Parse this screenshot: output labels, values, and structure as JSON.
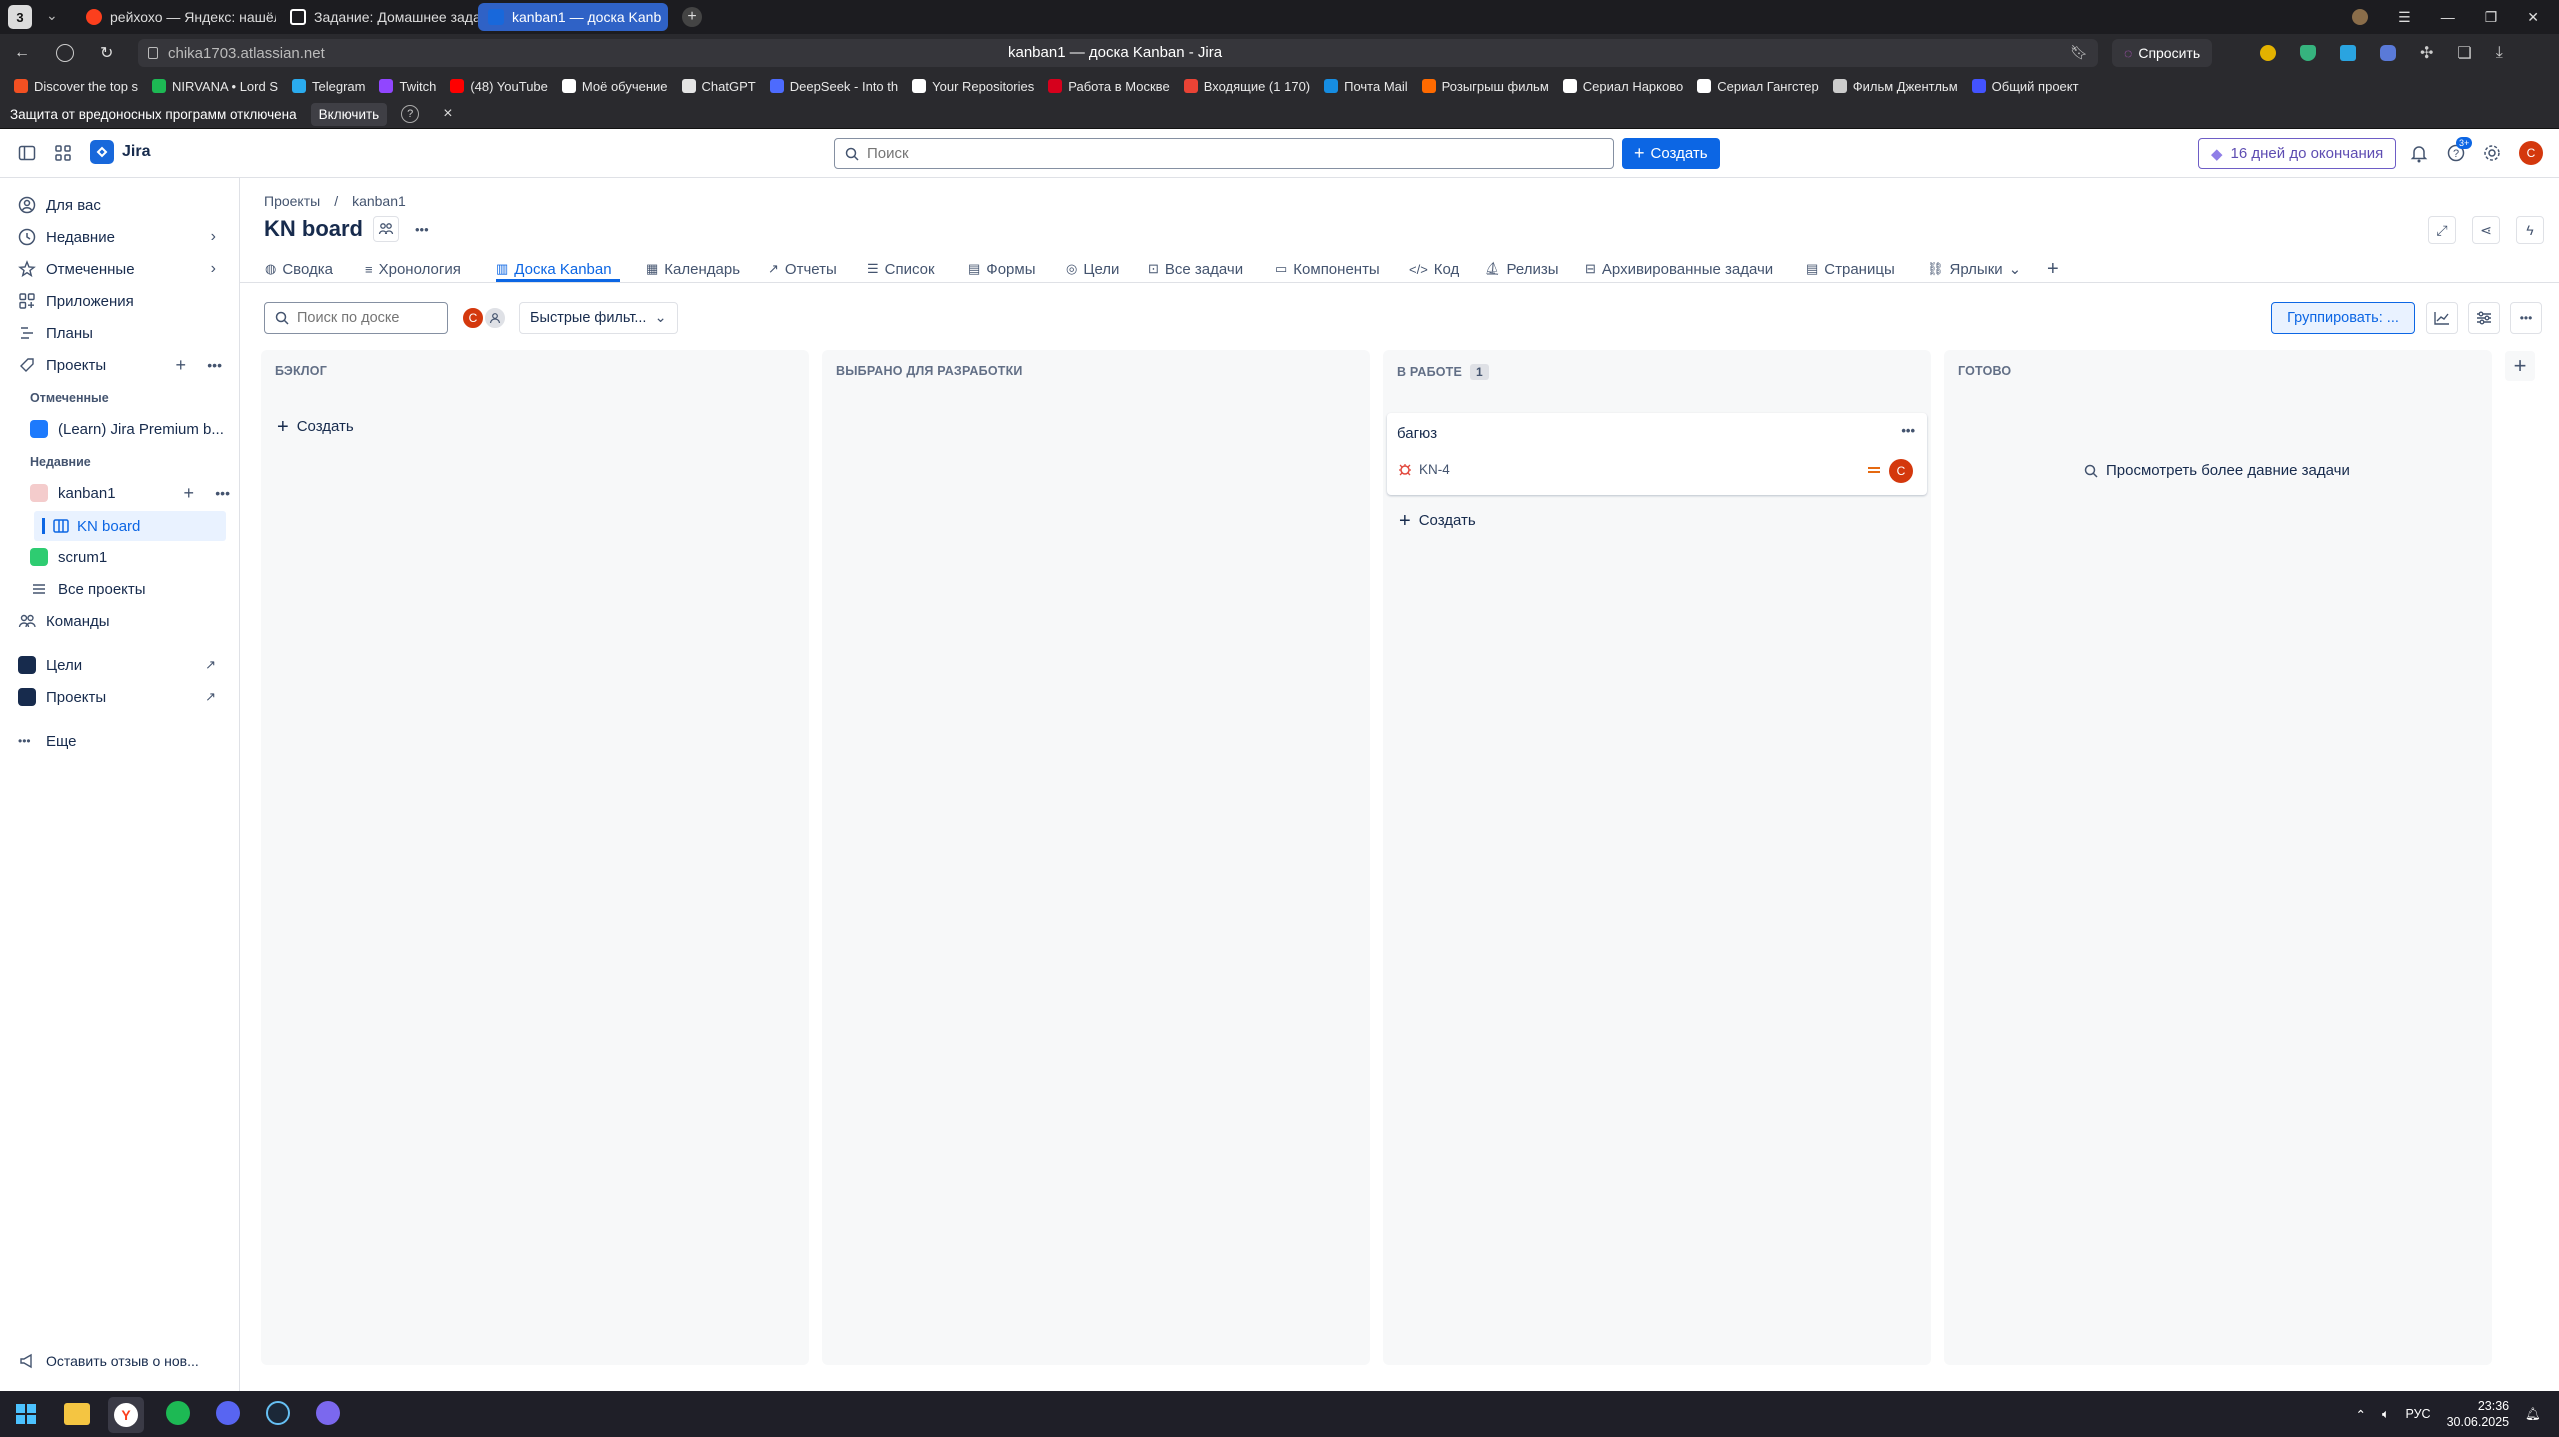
{
  "browser": {
    "tab_counter": "3",
    "tabs": [
      {
        "label": "рейхохо — Яндекс: нашёл",
        "favicon_color": "#fc3f1d"
      },
      {
        "label": "Задание: Домашнее зада",
        "favicon_color": "#ffffff"
      },
      {
        "label": "kanban1 — доска Kanb",
        "favicon_color": "#1868db"
      }
    ],
    "url": "chika1703.atlassian.net",
    "page_title": "kanban1 — доска Kanban - Jira",
    "ask_label": "Спросить",
    "bookmarks": [
      {
        "label": "Discover the top s",
        "color": "#f25022"
      },
      {
        "label": "NIRVANA • Lord S",
        "color": "#1db954"
      },
      {
        "label": "Telegram",
        "color": "#2aabee"
      },
      {
        "label": "Twitch",
        "color": "#9146ff"
      },
      {
        "label": "(48) YouTube",
        "color": "#ff0000"
      },
      {
        "label": "Моё обучение",
        "color": "#ffffff"
      },
      {
        "label": "ChatGPT",
        "color": "#e5e5e5"
      },
      {
        "label": "DeepSeek - Into th",
        "color": "#4d6bfe"
      },
      {
        "label": "Your Repositories",
        "color": "#ffffff"
      },
      {
        "label": "Работа в Москве",
        "color": "#d6001c"
      },
      {
        "label": "Входящие (1 170)",
        "color": "#ea4335"
      },
      {
        "label": "Почта Mail",
        "color": "#168de2"
      },
      {
        "label": "Розыгрыш фильм",
        "color": "#ff6a00"
      },
      {
        "label": "Сериал Нарково",
        "color": "#ffffff"
      },
      {
        "label": "Сериал Гангстер",
        "color": "#ffffff"
      },
      {
        "label": "Фильм Джентльм",
        "color": "#cccccc"
      },
      {
        "label": "Общий проект",
        "color": "#4353ff"
      }
    ],
    "warning": {
      "text": "Защита от вредоносных программ отключена",
      "button": "Включить",
      "help": "?",
      "close": "×"
    }
  },
  "jira": {
    "logo_text": "Jira",
    "search_placeholder": "Поиск",
    "create_button": "Создать",
    "trial_label": "16 дней до окончания",
    "help_badge": "3+",
    "avatar_letter": "C",
    "colors": {
      "primary": "#0c66e4",
      "avatar": "#d4380d",
      "purple": "#6e5dc6"
    }
  },
  "sidebar": {
    "items": [
      {
        "label": "Для вас"
      },
      {
        "label": "Недавние"
      },
      {
        "label": "Отмеченные"
      },
      {
        "label": "Приложения"
      },
      {
        "label": "Планы"
      },
      {
        "label": "Проекты"
      }
    ],
    "starred_heading": "Отмеченные",
    "starred_project": "(Learn) Jira Premium b...",
    "recent_heading": "Недавние",
    "recent_project": "kanban1",
    "board_item": "KN board",
    "scrum_project": "scrum1",
    "all_projects": "Все проекты",
    "teams": "Команды",
    "goals": "Цели",
    "projects_link": "Проекты",
    "more": "Еще",
    "feedback": "Оставить отзыв о нов..."
  },
  "project": {
    "breadcrumb_root": "Проекты",
    "breadcrumb_sep": "/",
    "breadcrumb_project": "kanban1",
    "title": "KN board",
    "tabs": [
      {
        "label": "Сводка"
      },
      {
        "label": "Хронология"
      },
      {
        "label": "Доска Kanban"
      },
      {
        "label": "Календарь"
      },
      {
        "label": "Отчеты"
      },
      {
        "label": "Список"
      },
      {
        "label": "Формы"
      },
      {
        "label": "Цели"
      },
      {
        "label": "Все задачи"
      },
      {
        "label": "Компоненты"
      },
      {
        "label": "Код"
      },
      {
        "label": "Релизы"
      },
      {
        "label": "Архивированные задачи"
      },
      {
        "label": "Страницы"
      },
      {
        "label": "Ярлыки"
      }
    ]
  },
  "board": {
    "search_placeholder": "Поиск по доске",
    "quick_filters": "Быстрые фильт...",
    "group_by": "Группировать: ...",
    "columns": [
      {
        "title": "БЭКЛОГ",
        "count": "",
        "create": "Создать"
      },
      {
        "title": "ВЫБРАНО ДЛЯ РАЗРАБОТКИ",
        "count": "",
        "create": ""
      },
      {
        "title": "В РАБОТЕ",
        "count": "1",
        "create": "Создать"
      },
      {
        "title": "ГОТОВО",
        "count": "",
        "create": ""
      }
    ],
    "card": {
      "summary": "багюз",
      "key": "KN-4",
      "assignee": "C"
    },
    "older_tasks": "Просмотреть более давние задачи"
  },
  "taskbar": {
    "lang": "РУС",
    "time": "23:36",
    "date": "30.06.2025"
  }
}
